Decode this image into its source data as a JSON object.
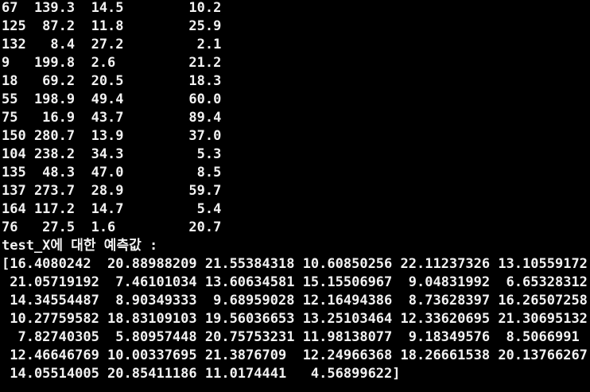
{
  "terminal": {
    "table_rows": [
      {
        "index": "67",
        "c1": "139.3",
        "c2": "14.5",
        "c3": "10.2"
      },
      {
        "index": "125",
        "c1": "87.2",
        "c2": "11.8",
        "c3": "25.9"
      },
      {
        "index": "132",
        "c1": "8.4",
        "c2": "27.2",
        "c3": "2.1"
      },
      {
        "index": "9",
        "c1": "199.8",
        "c2": "2.6",
        "c3": "21.2"
      },
      {
        "index": "18",
        "c1": "69.2",
        "c2": "20.5",
        "c3": "18.3"
      },
      {
        "index": "55",
        "c1": "198.9",
        "c2": "49.4",
        "c3": "60.0"
      },
      {
        "index": "75",
        "c1": "16.9",
        "c2": "43.7",
        "c3": "89.4"
      },
      {
        "index": "150",
        "c1": "280.7",
        "c2": "13.9",
        "c3": "37.0"
      },
      {
        "index": "104",
        "c1": "238.2",
        "c2": "34.3",
        "c3": "5.3"
      },
      {
        "index": "135",
        "c1": "48.3",
        "c2": "47.0",
        "c3": "8.5"
      },
      {
        "index": "137",
        "c1": "273.7",
        "c2": "28.9",
        "c3": "59.7"
      },
      {
        "index": "164",
        "c1": "117.2",
        "c2": "14.7",
        "c3": "5.4"
      },
      {
        "index": "76",
        "c1": "27.5",
        "c2": "1.6",
        "c3": "20.7"
      }
    ],
    "prediction_header": "test_X에 대한 예측값 :",
    "prediction_lines": [
      "[16.4080242  20.88988209 21.55384318 10.60850256 22.11237326 13.10559172",
      " 21.05719192  7.46101034 13.60634581 15.15506967  9.04831992  6.65328312",
      " 14.34554487  8.90349333  9.68959028 12.16494386  8.73628397 16.26507258",
      " 10.27759582 18.83109103 19.56036653 13.25103464 12.33620695 21.30695132",
      "  7.82740305  5.80957448 20.75753231 11.98138077  9.18349576  8.5066991",
      " 12.46646769 10.00337695 21.3876709  12.24966368 18.26661538 20.13766267",
      " 14.05514005 20.85411186 11.0174441   4.56899622]"
    ]
  }
}
